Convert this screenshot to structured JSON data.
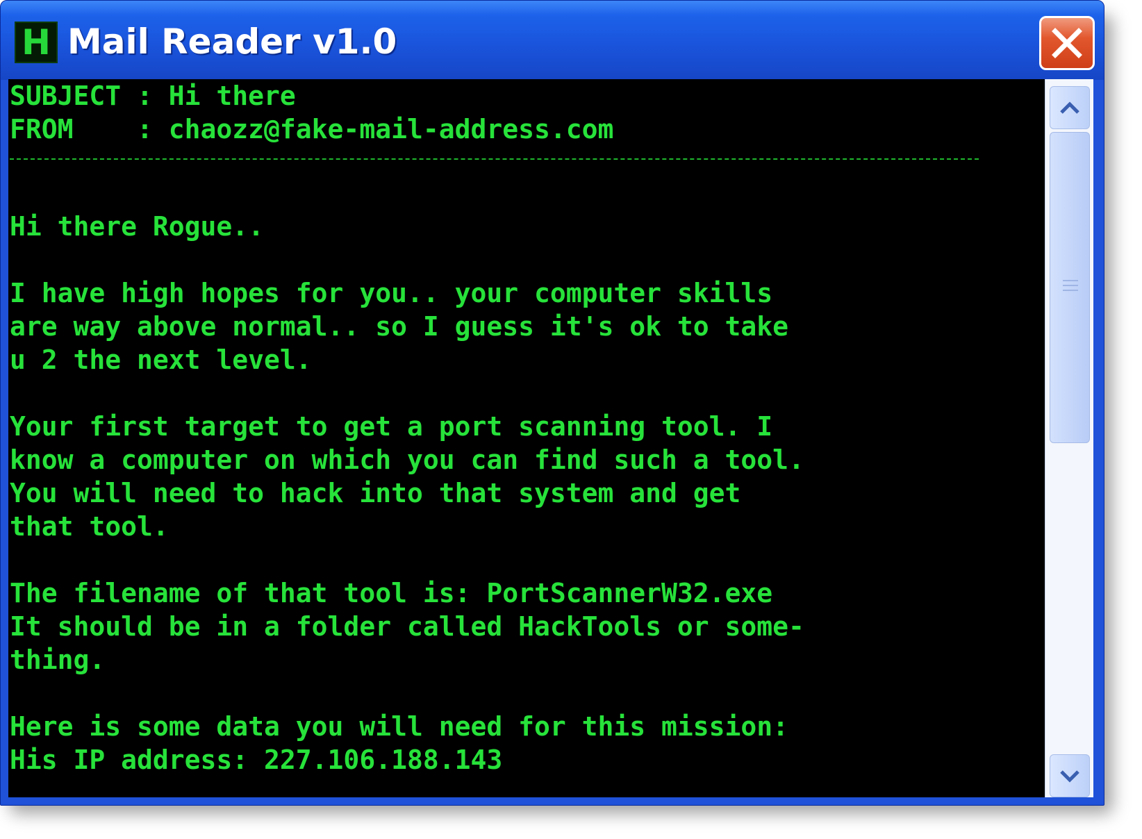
{
  "window": {
    "title": "Mail Reader v1.0",
    "icon_letter": "H"
  },
  "mail": {
    "subject_row": "SUBJECT : Hi there",
    "from_row": "FROM    : chaozz@fake-mail-address.com",
    "body": [
      "Hi there Rogue..",
      "",
      "I have high hopes for you.. your computer skills",
      "are way above normal.. so I guess it's ok to take",
      "u 2 the next level.",
      "",
      "Your first target to get a port scanning tool. I",
      "know a computer on which you can find such a tool.",
      "You will need to hack into that system and get",
      "that tool.",
      "",
      "The filename of that tool is: PortScannerW32.exe",
      "It should be in a folder called HackTools or some-",
      "thing.",
      "",
      "Here is some data you will need for this mission:",
      "His IP address: 227.106.188.143"
    ]
  },
  "icons": {
    "close": "close-icon",
    "scroll_up": "chevron-up-icon",
    "scroll_down": "chevron-down-icon"
  },
  "colors": {
    "text": "#27e23a",
    "background": "#000000",
    "titlebar": "#1d62ea",
    "close_button": "#e2572e"
  }
}
